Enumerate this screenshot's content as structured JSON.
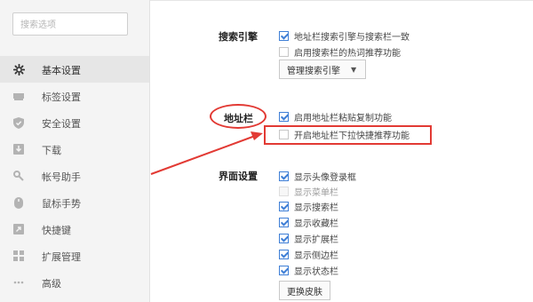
{
  "sidebar": {
    "search_placeholder": "搜索选项",
    "items": [
      {
        "label": "基本设置",
        "icon": "gear-icon",
        "active": true
      },
      {
        "label": "标签设置",
        "icon": "tab-icon",
        "active": false
      },
      {
        "label": "安全设置",
        "icon": "shield-icon",
        "active": false
      },
      {
        "label": "下载",
        "icon": "download-icon",
        "active": false
      },
      {
        "label": "帐号助手",
        "icon": "key-icon",
        "active": false
      },
      {
        "label": "鼠标手势",
        "icon": "mouse-icon",
        "active": false
      },
      {
        "label": "快捷键",
        "icon": "shortcut-icon",
        "active": false
      },
      {
        "label": "扩展管理",
        "icon": "extensions-icon",
        "active": false
      },
      {
        "label": "高级",
        "icon": "more-icon",
        "active": false
      }
    ]
  },
  "search_engine": {
    "title": "搜索引擎",
    "options": [
      {
        "label": "地址栏搜索引擎与搜索栏一致",
        "checked": true
      },
      {
        "label": "启用搜索栏的热词推荐功能",
        "checked": false
      }
    ],
    "manage_button": "管理搜索引擎"
  },
  "address_bar": {
    "title": "地址栏",
    "options": [
      {
        "label": "启用地址栏粘贴复制功能",
        "checked": true
      },
      {
        "label": "开启地址栏下拉快捷推荐功能",
        "checked": false
      }
    ]
  },
  "interface": {
    "title": "界面设置",
    "options": [
      {
        "label": "显示头像登录框",
        "checked": true,
        "disabled": false
      },
      {
        "label": "显示菜单栏",
        "checked": false,
        "disabled": true
      },
      {
        "label": "显示搜索栏",
        "checked": true,
        "disabled": false
      },
      {
        "label": "显示收藏栏",
        "checked": true,
        "disabled": false
      },
      {
        "label": "显示扩展栏",
        "checked": true,
        "disabled": false
      },
      {
        "label": "显示侧边栏",
        "checked": true,
        "disabled": false
      },
      {
        "label": "显示状态栏",
        "checked": true,
        "disabled": false
      }
    ],
    "skin_button": "更换皮肤"
  },
  "colors": {
    "accent": "#3f7fd6",
    "annotation": "#e23a34"
  }
}
